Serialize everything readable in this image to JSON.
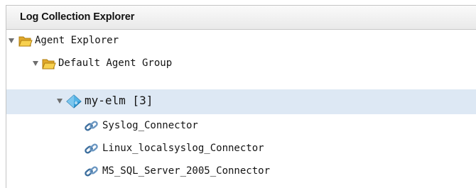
{
  "panel": {
    "title": "Log Collection Explorer"
  },
  "tree": {
    "root": {
      "label": "Agent Explorer",
      "icon": "open-folder-icon",
      "expanded": true
    },
    "group": {
      "label": "Default Agent Group",
      "icon": "open-folder-icon",
      "expanded": true
    },
    "agent": {
      "label": "my-elm [3]",
      "icon": "blue-diamond-agent-icon",
      "expanded": true,
      "selected": true
    },
    "connectors": [
      {
        "label": "Syslog_Connector",
        "icon": "connector-link-icon"
      },
      {
        "label": "Linux_localsyslog_Connector",
        "icon": "connector-link-icon"
      },
      {
        "label": "MS_SQL_Server_2005_Connector",
        "icon": "connector-link-icon"
      }
    ]
  },
  "colors": {
    "selection": "#dde8f4",
    "folder": "#f2c23a",
    "agent": "#2f9bd8",
    "connector": "#3d6f9e"
  }
}
